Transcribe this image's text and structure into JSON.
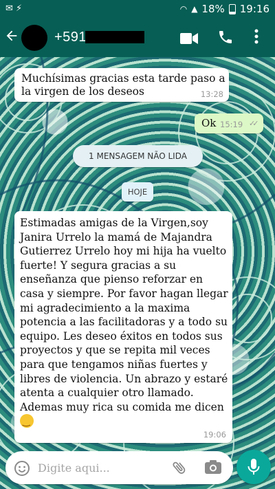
{
  "status_bar": {
    "battery": "18%",
    "time": "19:16"
  },
  "header": {
    "contact_prefix": "+591",
    "icons": [
      "back-arrow-icon",
      "video-call-icon",
      "phone-call-icon",
      "more-vertical-icon"
    ]
  },
  "messages": [
    {
      "direction": "incoming",
      "text": "Muchísimas gracias esta tarde paso  a la  virgen de los deseos",
      "time": "13:28"
    },
    {
      "direction": "outgoing",
      "text": "Ok",
      "time": "15:19",
      "status": "read"
    },
    {
      "direction": "incoming",
      "text": "Estimadas amigas de la Virgen,soy Janira Urrelo la mamá de Majandra Gutierrez Urrelo hoy mi hija ha vuelto fuerte! Y segura gracias a su enseñanza que pienso reforzar en casa y siempre. Por favor hagan llegar mi agradecimiento a la maxima potencia a las facilitadoras y a todo su equipo.  Les deseo éxitos en todos sus proyectos   y que se repita mil veces para que tengamos niñas fuertes y libres de violencia.  Un abrazo y estaré atenta a cualquier otro llamado.  Ademas muy rica su comida me dicen",
      "time": "19:06"
    }
  ],
  "unread_banner": "1 MENSAGEM NÃO LIDA",
  "date_divider": "HOJE",
  "composer": {
    "placeholder": "Digite aqui...",
    "icons": [
      "emoji-icon",
      "attach-icon",
      "camera-icon",
      "mic-icon"
    ]
  },
  "colors": {
    "header": "#075e54",
    "outgoing_bubble": "#dcf8c6",
    "incoming_bubble": "#ffffff",
    "mic_button": "#0aa89b"
  }
}
